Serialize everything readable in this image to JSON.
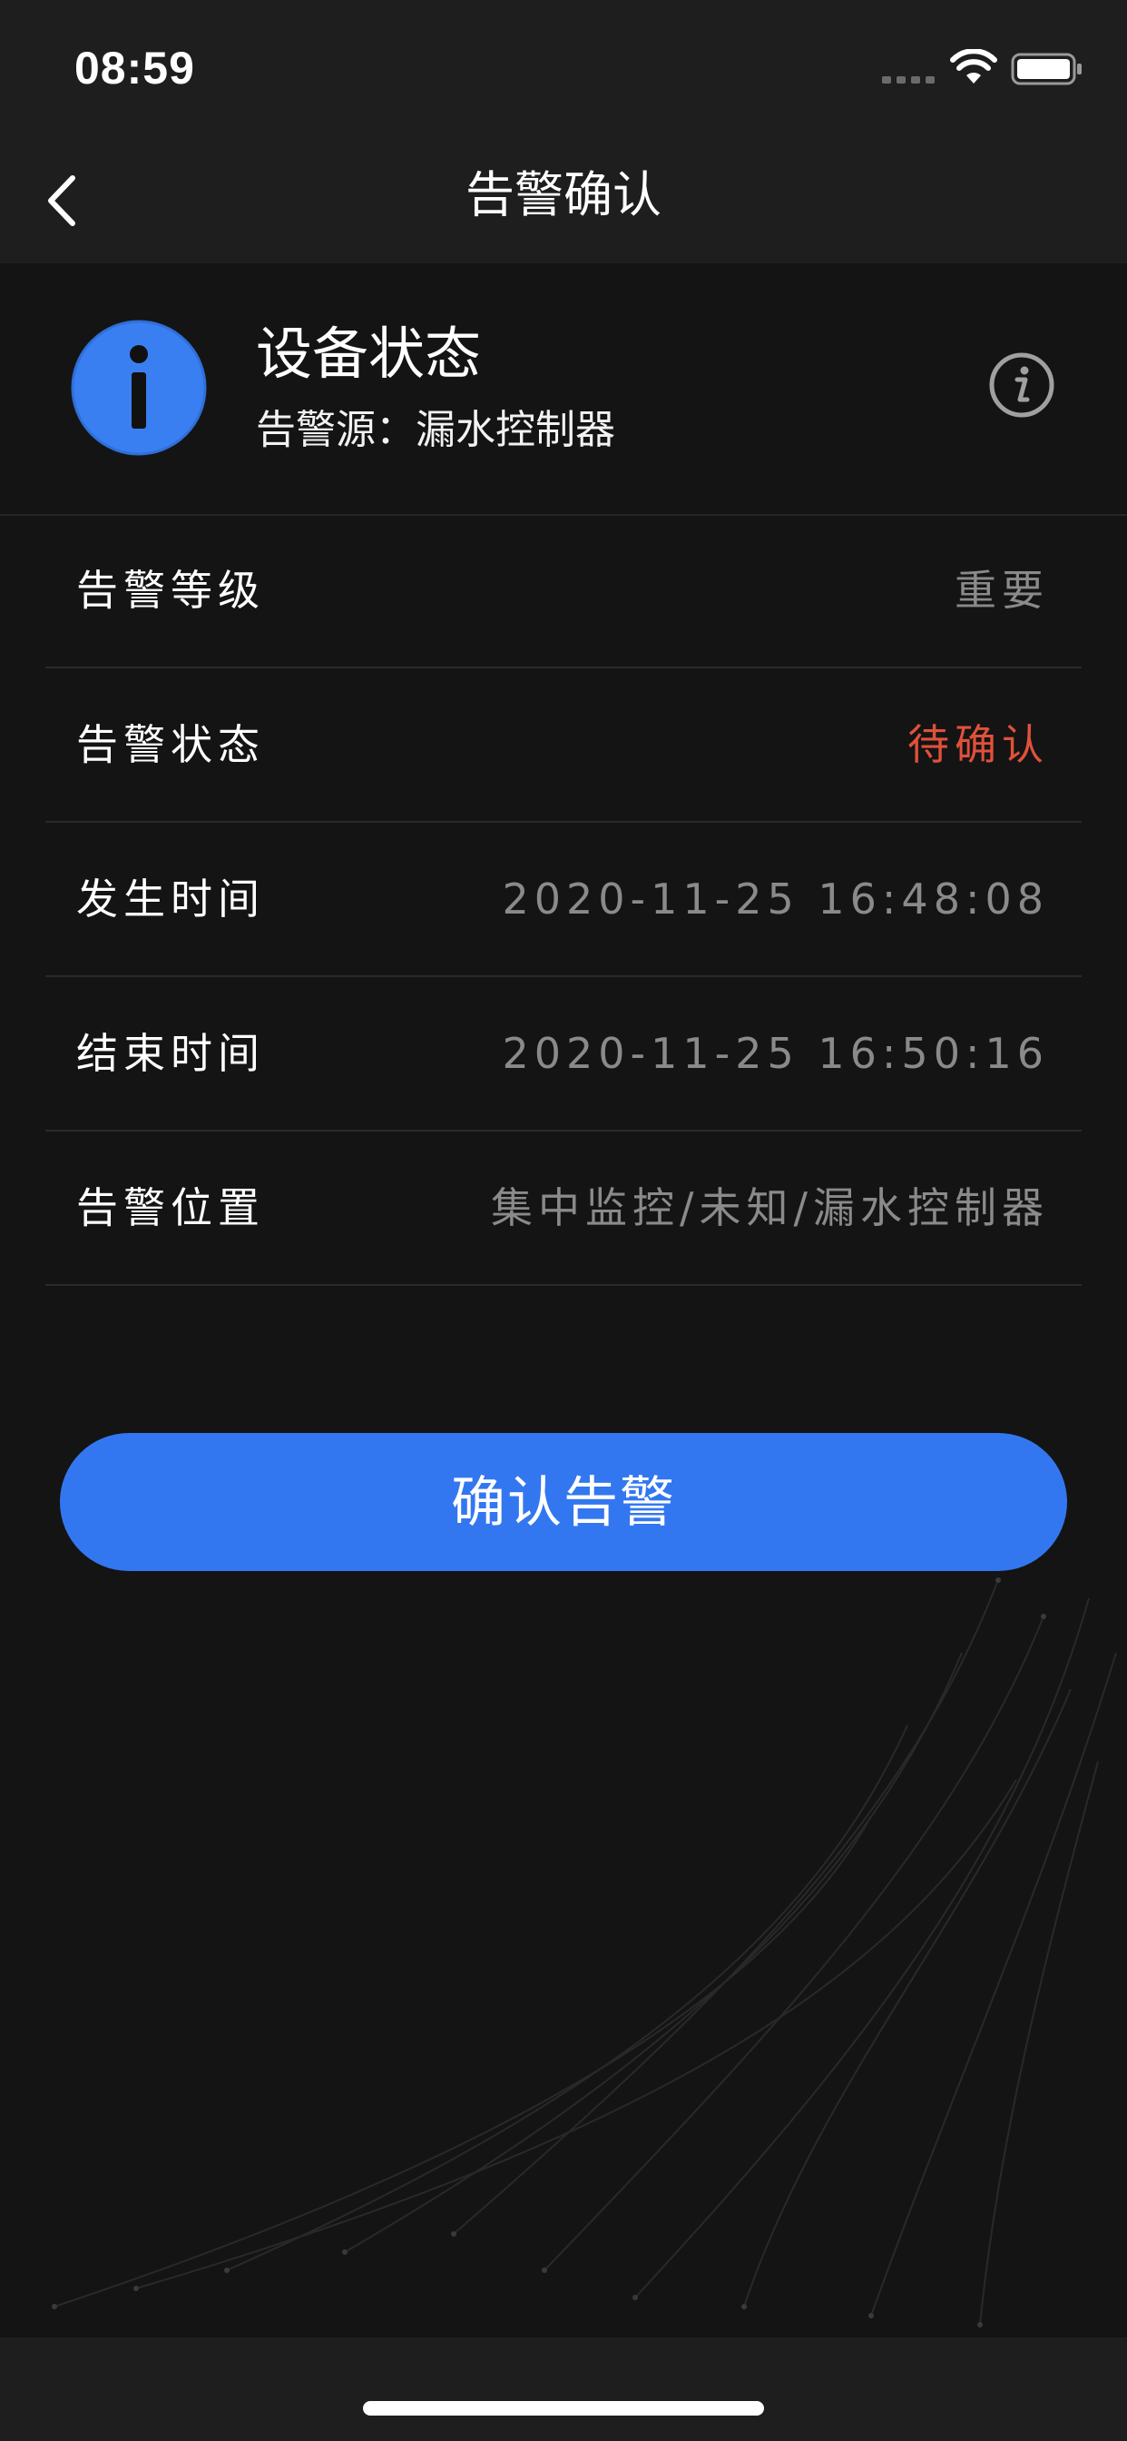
{
  "status_bar": {
    "time": "08:59"
  },
  "nav": {
    "title": "告警确认"
  },
  "header": {
    "title": "设备状态",
    "source_text": "告警源：漏水控制器"
  },
  "details": [
    {
      "label": "告警等级",
      "value": "重要"
    },
    {
      "label": "告警状态",
      "value": "待确认"
    },
    {
      "label": "发生时间",
      "value": "2020-11-25 16:48:08"
    },
    {
      "label": "结束时间",
      "value": "2020-11-25 16:50:16"
    },
    {
      "label": "告警位置",
      "value": "集中监控/未知/漏水控制器"
    }
  ],
  "actions": {
    "confirm_label": "确认告警"
  },
  "colors": {
    "accent": "#3377f0",
    "alert_status": "#e0513a",
    "background": "#141414"
  }
}
